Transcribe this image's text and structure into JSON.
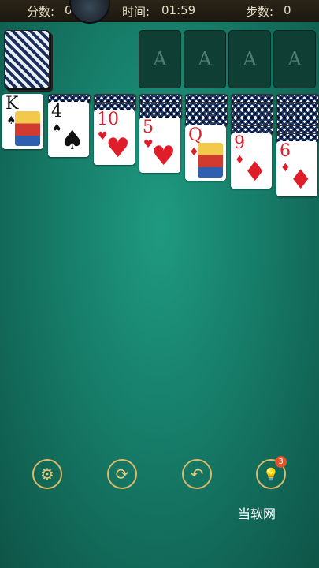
{
  "topbar": {
    "score_label": "分数:",
    "score_value": "0",
    "time_label": "时间:",
    "time_value": "01:59",
    "moves_label": "步数:",
    "moves_value": "0"
  },
  "foundations": [
    "A",
    "A",
    "A",
    "A"
  ],
  "tableau": [
    {
      "rank": "K",
      "suit": "♠",
      "color": "#111111",
      "face": true
    },
    {
      "rank": "4",
      "suit": "♠",
      "color": "#111111",
      "face": false
    },
    {
      "rank": "10",
      "suit": "♥",
      "color": "#e01e2a",
      "face": false
    },
    {
      "rank": "5",
      "suit": "♥",
      "color": "#e01e2a",
      "face": false
    },
    {
      "rank": "Q",
      "suit": "♦",
      "color": "#e01e2a",
      "face": true
    },
    {
      "rank": "9",
      "suit": "♦",
      "color": "#e01e2a",
      "face": false
    },
    {
      "rank": "6",
      "suit": "♦",
      "color": "#e01e2a",
      "face": false
    }
  ],
  "buttons": {
    "settings": "⚙",
    "restart": "⟳",
    "undo": "↶",
    "hint": "💡",
    "hint_badge": "3"
  },
  "watermark": "当软网"
}
